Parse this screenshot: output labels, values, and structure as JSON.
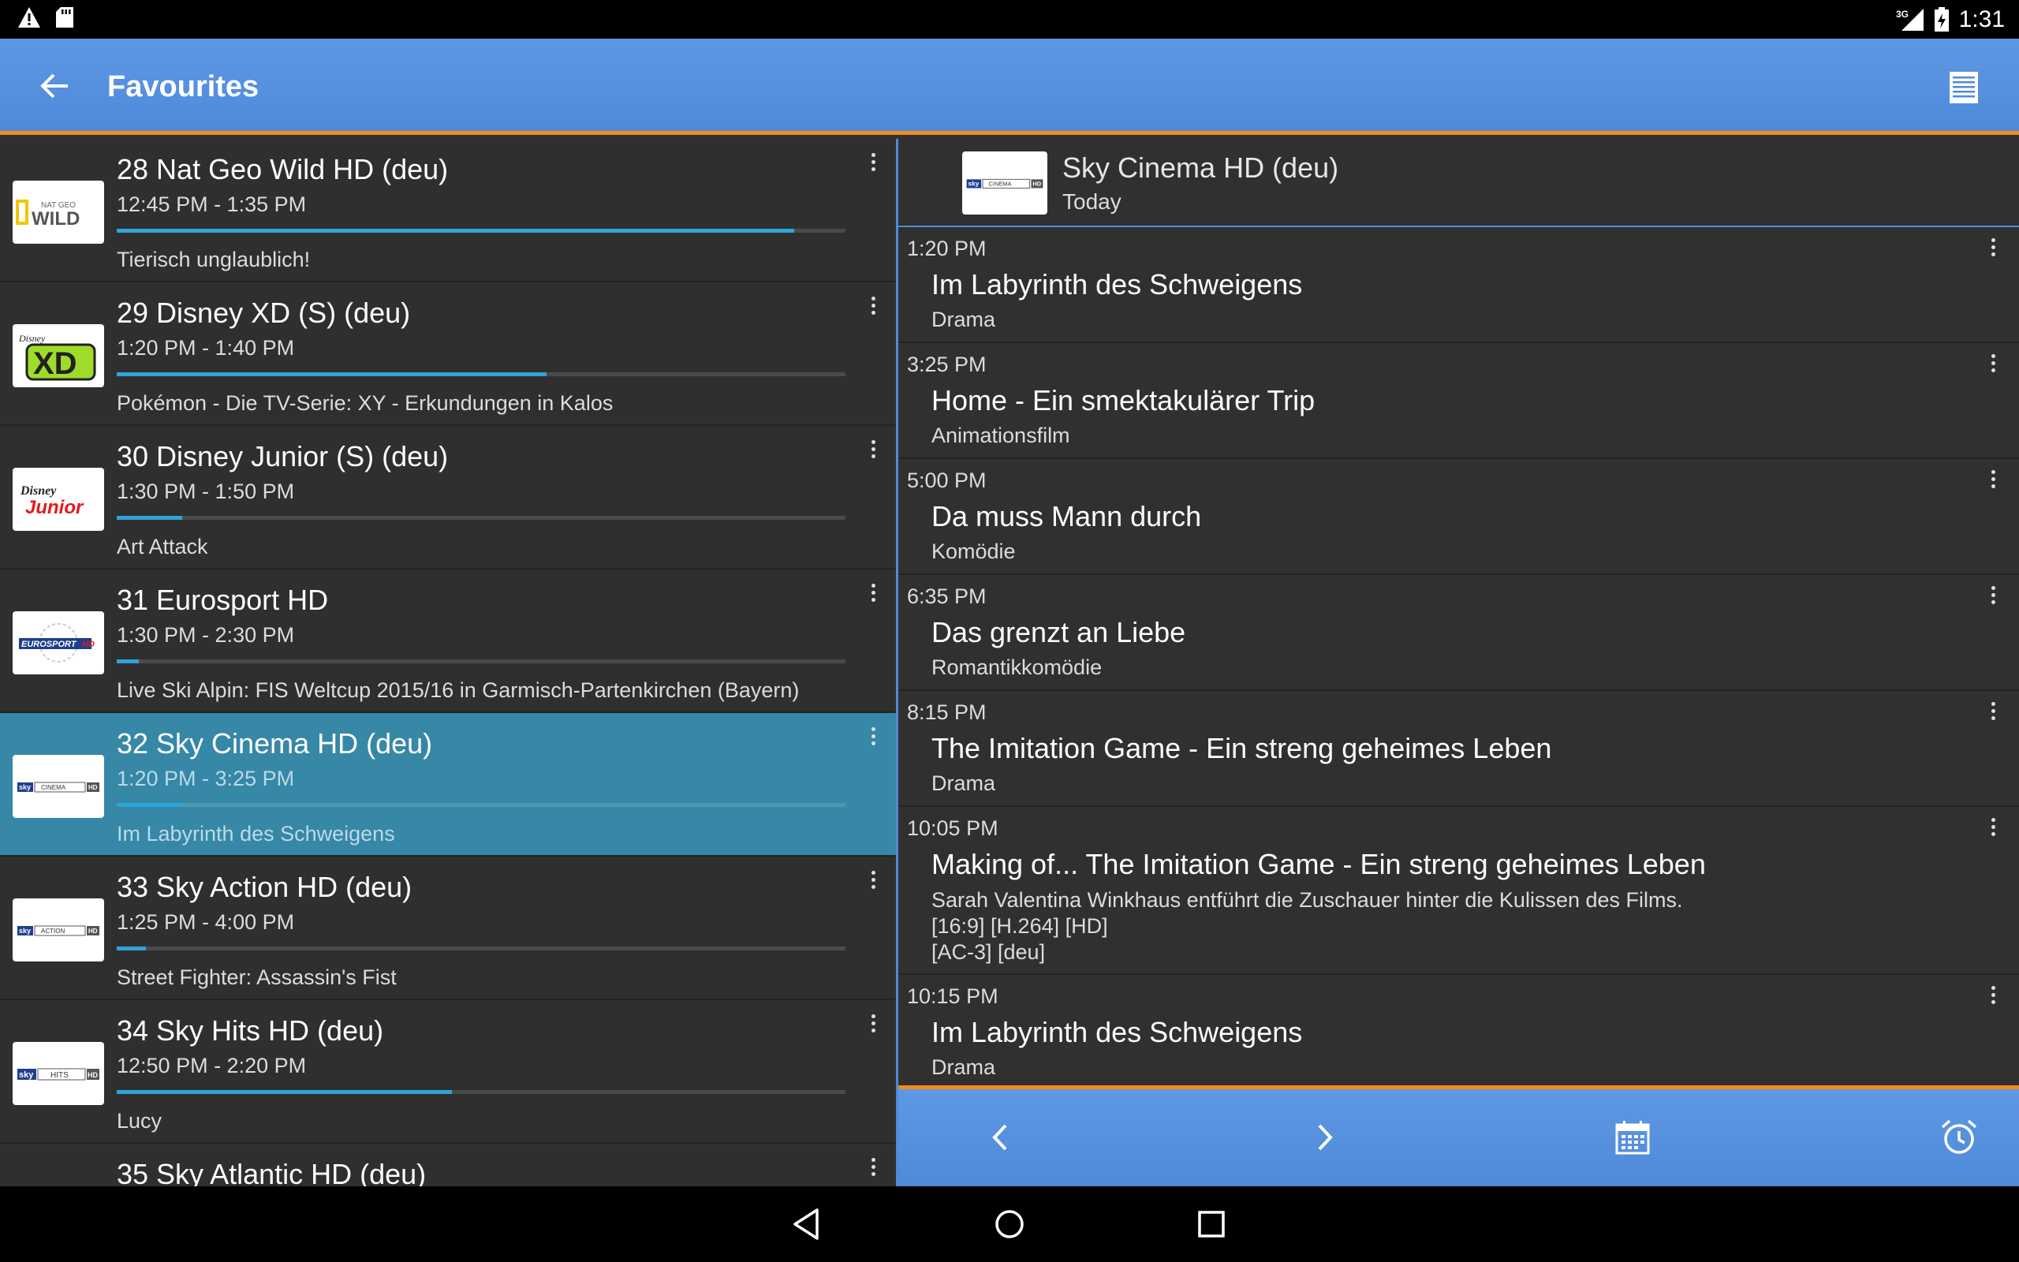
{
  "status": {
    "time": "1:31",
    "network": "3G"
  },
  "appbar": {
    "title": "Favourites"
  },
  "channels": [
    {
      "name": "28 Nat Geo Wild HD (deu)",
      "time": "12:45 PM - 1:35 PM",
      "show": "Tierisch unglaublich!",
      "progress": 0.93,
      "selected": false,
      "logo": "natgeo-wild"
    },
    {
      "name": "29 Disney XD (S) (deu)",
      "time": "1:20 PM - 1:40 PM",
      "show": "Pokémon - Die TV-Serie: XY - Erkundungen in Kalos",
      "progress": 0.59,
      "selected": false,
      "logo": "disney-xd"
    },
    {
      "name": "30 Disney Junior (S) (deu)",
      "time": "1:30 PM - 1:50 PM",
      "show": "Art Attack",
      "progress": 0.09,
      "selected": false,
      "logo": "disney-junior"
    },
    {
      "name": "31 Eurosport HD",
      "time": "1:30 PM - 2:30 PM",
      "show": "Live Ski Alpin: FIS Weltcup 2015/16 in Garmisch-Partenkirchen (Bayern)",
      "progress": 0.03,
      "selected": false,
      "logo": "eurosport-hd"
    },
    {
      "name": "32 Sky Cinema HD (deu)",
      "time": "1:20 PM - 3:25 PM",
      "show": "Im Labyrinth des Schweigens",
      "progress": 0.09,
      "selected": true,
      "logo": "sky-cinema-hd"
    },
    {
      "name": "33 Sky Action HD (deu)",
      "time": "1:25 PM - 4:00 PM",
      "show": "Street Fighter: Assassin's Fist",
      "progress": 0.04,
      "selected": false,
      "logo": "sky-action-hd"
    },
    {
      "name": "34 Sky Hits HD (deu)",
      "time": "12:50 PM - 2:20 PM",
      "show": "Lucy",
      "progress": 0.46,
      "selected": false,
      "logo": "sky-hits-hd"
    },
    {
      "name": "35 Sky Atlantic HD (deu)",
      "time": "",
      "show": "",
      "progress": 0,
      "selected": false,
      "logo": "sky-atlantic-hd"
    }
  ],
  "detail": {
    "channel": "Sky Cinema HD (deu)",
    "day": "Today",
    "programs": [
      {
        "time": "1:20 PM",
        "title": "Im Labyrinth des Schweigens",
        "genre": "Drama"
      },
      {
        "time": "3:25 PM",
        "title": "Home - Ein smektakulärer Trip",
        "genre": "Animationsfilm"
      },
      {
        "time": "5:00 PM",
        "title": "Da muss Mann durch",
        "genre": "Komödie"
      },
      {
        "time": "6:35 PM",
        "title": "Das grenzt an Liebe",
        "genre": "Romantikkomödie"
      },
      {
        "time": "8:15 PM",
        "title": "The Imitation Game - Ein streng geheimes Leben",
        "genre": "Drama"
      },
      {
        "time": "10:05 PM",
        "title": "Making of... The Imitation Game - Ein streng geheimes Leben",
        "genre": "",
        "description": [
          "Sarah Valentina Winkhaus entführt die Zuschauer hinter die Kulissen des Films.",
          "[16:9] [H.264] [HD]",
          "[AC-3] [deu]"
        ]
      },
      {
        "time": "10:15 PM",
        "title": "Im Labyrinth des Schweigens",
        "genre": "Drama"
      }
    ]
  },
  "logos": {
    "natgeo_top": "NAT GEO",
    "natgeo_main": "WILD",
    "disney": "Disney",
    "xd": "XD",
    "junior": "Junior",
    "eurosport": "EUROSPORT",
    "hd": "HD",
    "sky": "sky",
    "cinema": "CINEMA",
    "action": "ACTION",
    "hits": "HITS"
  },
  "colors": {
    "accent": "#4f8ad9",
    "highlight": "#f08c1e",
    "selected_row": "#3787a6",
    "progress": "#2ea4d9"
  }
}
